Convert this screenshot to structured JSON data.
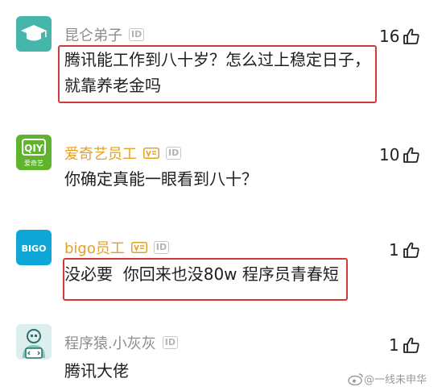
{
  "comments": [
    {
      "username": "昆仑弟子",
      "badges": [
        "ID"
      ],
      "text_lines": [
        "腾讯能工作到八十岁？怎么过上稳定日子，",
        "就靠养老金吗"
      ],
      "likes": "16",
      "avatar": "graduation-cap-logo",
      "name_color": "#8c8c8c",
      "highlighted": true
    },
    {
      "username": "爱奇艺员工",
      "badges": [
        "verified-employee",
        "ID"
      ],
      "avatar_text": [
        "iQIYI",
        "爱奇艺"
      ],
      "text_lines": [
        "你确定真能一眼看到八十？"
      ],
      "likes": "10",
      "avatar": "iqiyi-logo",
      "name_color": "#e6a023",
      "highlighted": false
    },
    {
      "username": "bigo员工",
      "badges": [
        "verified-employee",
        "ID"
      ],
      "avatar_text": [
        "BIGO"
      ],
      "text_lines": [
        "没必要  你回来也没80w 程序员青春短"
      ],
      "likes": "1",
      "avatar": "bigo-logo",
      "name_color": "#e6a023",
      "highlighted": true
    },
    {
      "username": "程序猿.小灰灰",
      "badges": [
        "ID"
      ],
      "text_lines": [
        "腾讯大佬"
      ],
      "likes": "1",
      "avatar": "coder-cartoon",
      "name_color": "#8c8c8c",
      "highlighted": false
    }
  ],
  "watermark": {
    "text": "@一线未申华",
    "icon": "weibo-icon"
  },
  "colors": {
    "highlight_border": "#d23a3a",
    "gold_name": "#e6a023",
    "gray_name": "#8c8c8c"
  }
}
